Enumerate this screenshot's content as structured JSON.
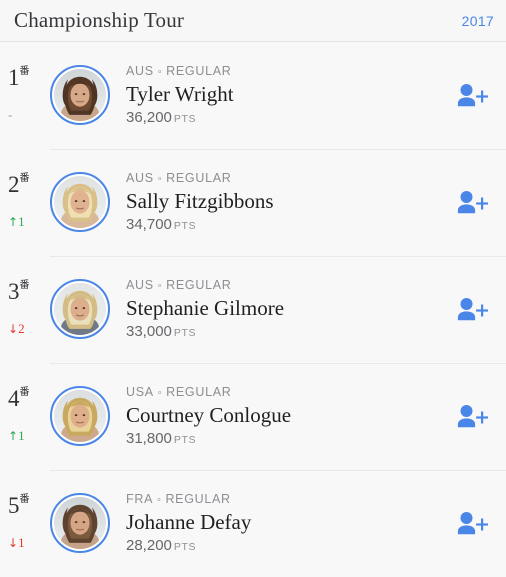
{
  "header": {
    "title": "Championship Tour",
    "year": "2017",
    "accent_color": "#4a86e8"
  },
  "list": {
    "rank_suffix": "番",
    "points_unit": "PTS",
    "meta_separator": "∘",
    "follow_icon": "add-person-icon",
    "up_arrow": "↑",
    "down_arrow": "↓",
    "flat_mark": "-",
    "rows": [
      {
        "rank": "1",
        "delta_arrow": "",
        "delta_value": "-",
        "delta_dir": "flat",
        "country": "AUS",
        "status": "REGULAR",
        "name": "Tyler Wright",
        "points": "36,200",
        "avatar": "portrait-tyler-wright"
      },
      {
        "rank": "2",
        "delta_arrow": "↑",
        "delta_value": "1",
        "delta_dir": "up",
        "country": "AUS",
        "status": "REGULAR",
        "name": "Sally Fitzgibbons",
        "points": "34,700",
        "avatar": "portrait-sally-fitzgibbons"
      },
      {
        "rank": "3",
        "delta_arrow": "↓",
        "delta_value": "2",
        "delta_dir": "down",
        "country": "AUS",
        "status": "REGULAR",
        "name": "Stephanie Gilmore",
        "points": "33,000",
        "avatar": "portrait-stephanie-gilmore"
      },
      {
        "rank": "4",
        "delta_arrow": "↑",
        "delta_value": "1",
        "delta_dir": "up",
        "country": "USA",
        "status": "REGULAR",
        "name": "Courtney Conlogue",
        "points": "31,800",
        "avatar": "portrait-courtney-conlogue"
      },
      {
        "rank": "5",
        "delta_arrow": "↓",
        "delta_value": "1",
        "delta_dir": "down",
        "country": "FRA",
        "status": "REGULAR",
        "name": "Johanne Defay",
        "points": "28,200",
        "avatar": "portrait-johanne-defay"
      }
    ]
  }
}
